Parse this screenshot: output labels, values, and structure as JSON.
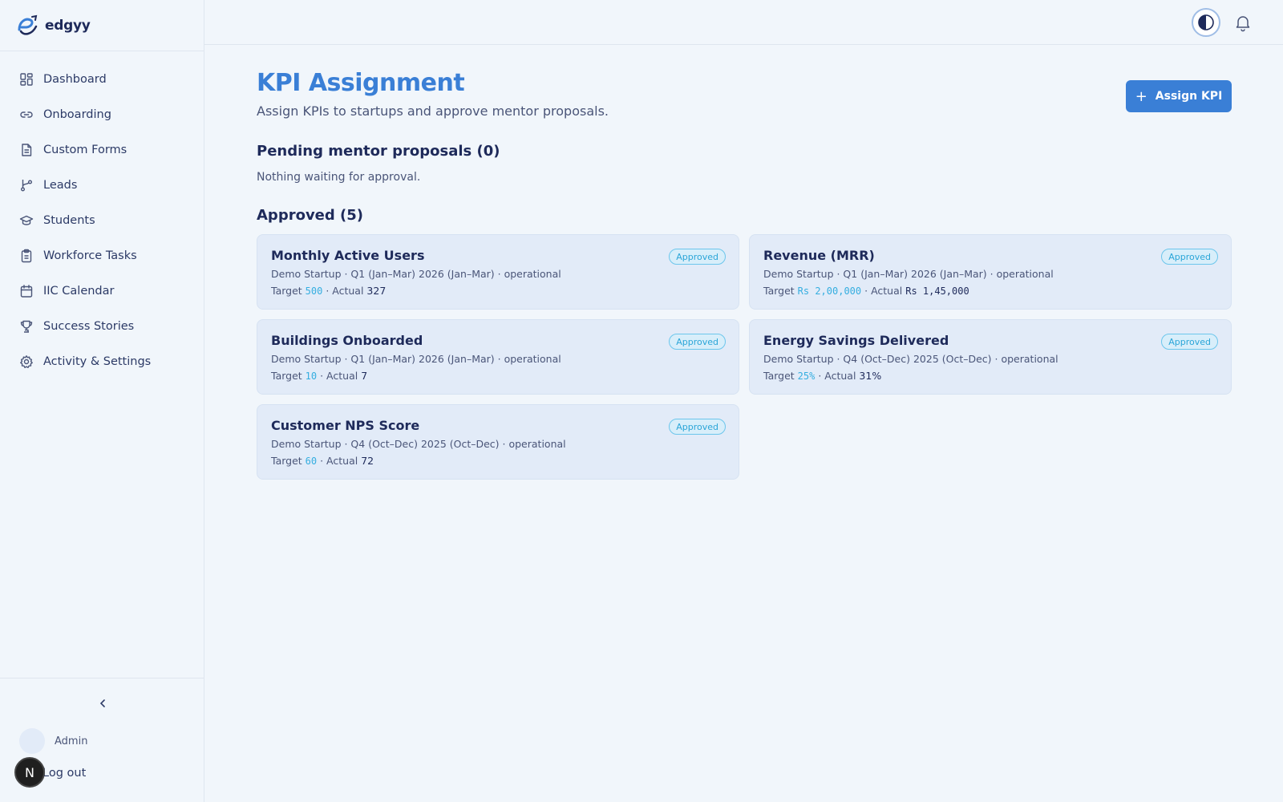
{
  "brand": {
    "name": "edgyy"
  },
  "sidebar": {
    "items": [
      {
        "label": "Dashboard",
        "icon": "dashboard-icon"
      },
      {
        "label": "Onboarding",
        "icon": "link-icon"
      },
      {
        "label": "Custom Forms",
        "icon": "document-icon"
      },
      {
        "label": "Leads",
        "icon": "branch-icon"
      },
      {
        "label": "Students",
        "icon": "graduation-cap-icon"
      },
      {
        "label": "Workforce Tasks",
        "icon": "clipboard-icon"
      },
      {
        "label": "IIC Calendar",
        "icon": "calendar-icon"
      },
      {
        "label": "Success Stories",
        "icon": "trophy-icon"
      },
      {
        "label": "Activity & Settings",
        "icon": "gear-icon"
      }
    ],
    "user": {
      "name": "Admin"
    },
    "logout_label": "Log out",
    "n_badge": "N"
  },
  "header": {
    "title": "KPI Assignment",
    "subtitle": "Assign KPIs to startups and approve mentor proposals.",
    "assign_button": "Assign KPI",
    "assign_button_icon": "+"
  },
  "pending": {
    "title": "Pending mentor proposals (0)",
    "empty_text": "Nothing waiting for approval."
  },
  "approved": {
    "title": "Approved (5)",
    "cards": [
      {
        "title": "Monthly Active Users",
        "meta": "Demo Startup · Q1 (Jan–Mar) 2026 (Jan–Mar) · operational",
        "target_label": "Target",
        "target": "500",
        "actual_label": "· Actual",
        "actual": "327",
        "actual_mono": false,
        "badge": "Approved"
      },
      {
        "title": "Revenue (MRR)",
        "meta": "Demo Startup · Q1 (Jan–Mar) 2026 (Jan–Mar) · operational",
        "target_label": "Target",
        "target": "Rs 2,00,000",
        "actual_label": "· Actual",
        "actual": "Rs 1,45,000",
        "actual_mono": true,
        "badge": "Approved"
      },
      {
        "title": "Buildings Onboarded",
        "meta": "Demo Startup · Q1 (Jan–Mar) 2026 (Jan–Mar) · operational",
        "target_label": "Target",
        "target": "10",
        "actual_label": "· Actual",
        "actual": "7",
        "actual_mono": false,
        "badge": "Approved"
      },
      {
        "title": "Energy Savings Delivered",
        "meta": "Demo Startup · Q4 (Oct–Dec) 2025 (Oct–Dec) · operational",
        "target_label": "Target",
        "target": "25%",
        "actual_label": "· Actual",
        "actual": "31%",
        "actual_mono": false,
        "badge": "Approved"
      },
      {
        "title": "Customer NPS Score",
        "meta": "Demo Startup · Q4 (Oct–Dec) 2025 (Oct–Dec) · operational",
        "target_label": "Target",
        "target": "60",
        "actual_label": "· Actual",
        "actual": "72",
        "actual_mono": false,
        "badge": "Approved"
      }
    ]
  },
  "colors": {
    "accent": "#3a7fd6",
    "badge": "#2aa5d8",
    "background": "#f1f6fb",
    "card": "#e2ebf8"
  }
}
